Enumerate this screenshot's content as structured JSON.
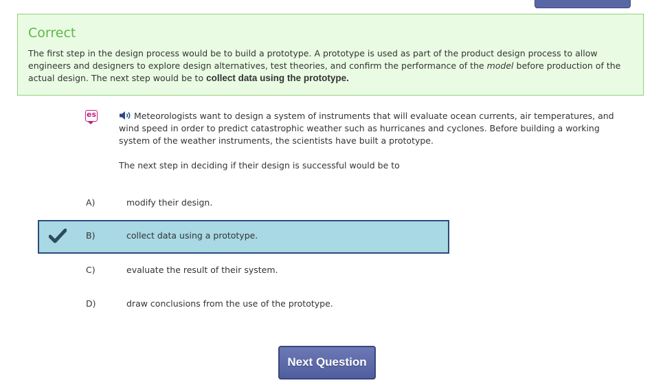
{
  "feedback": {
    "title": "Correct",
    "text_1": "The first step in the design process would be to build a prototype. A prototype is used as part of the product design process to allow engineers and designers to explore design alternatives, test theories, and confirm the performance of the ",
    "text_italic": "model",
    "text_2": " before production of the actual design. The next step would be to ",
    "text_bold": "collect data using the prototype."
  },
  "question": {
    "translate_badge": "es",
    "icon": "speaker-icon",
    "stem": "Meteorologists want to design a system of instruments that will evaluate ocean currents, air temperatures, and wind speed in order to predict catastrophic weather such as hurricanes and cyclones. Before building a working system of the weather instruments, the scientists have built a prototype.",
    "prompt": "The next step in deciding if their design is successful would be to"
  },
  "choices": [
    {
      "letter": "A)",
      "text": "modify their design.",
      "selected": false
    },
    {
      "letter": "B)",
      "text": "collect data using a prototype.",
      "selected": true
    },
    {
      "letter": "C)",
      "text": "evaluate the result of their system.",
      "selected": false
    },
    {
      "letter": "D)",
      "text": "draw conclusions from the use of the prototype.",
      "selected": false
    }
  ],
  "next_button": {
    "label": "Next Question"
  },
  "colors": {
    "correct_green": "#5cb848",
    "selected_bg": "#a8d9e4",
    "button_blue": "#5a67a6"
  }
}
